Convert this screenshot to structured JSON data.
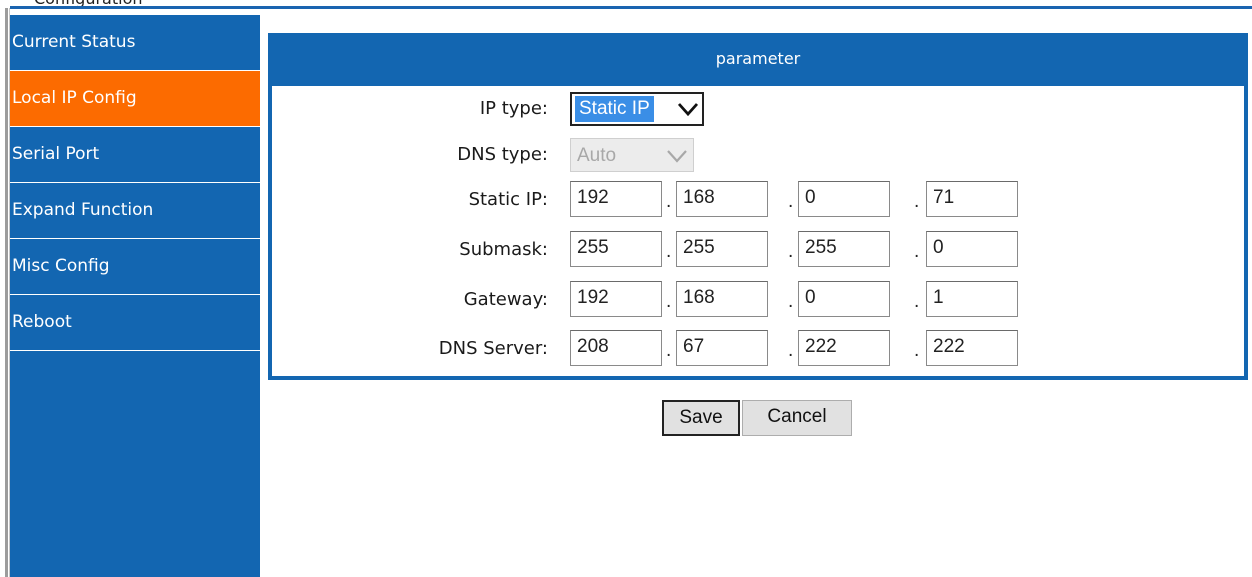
{
  "window": {
    "top_cut_text": "Configuration"
  },
  "sidebar": {
    "items": [
      {
        "label": "Current Status",
        "active": false
      },
      {
        "label": "Local IP Config",
        "active": true
      },
      {
        "label": "Serial Port",
        "active": false
      },
      {
        "label": "Expand Function",
        "active": false
      },
      {
        "label": "Misc Config",
        "active": false
      },
      {
        "label": "Reboot",
        "active": false
      }
    ]
  },
  "panel": {
    "title": "parameter",
    "ip_type": {
      "label": "IP type:",
      "value": "Static IP",
      "arrow_icon": "chevron-down-icon"
    },
    "dns_type": {
      "label": "DNS type:",
      "value": "Auto",
      "disabled": true,
      "arrow_icon": "chevron-down-icon"
    },
    "static_ip": {
      "label": "Static IP:",
      "octets": [
        "192",
        "168",
        "0",
        "71"
      ]
    },
    "submask": {
      "label": "Submask:",
      "octets": [
        "255",
        "255",
        "255",
        "0"
      ]
    },
    "gateway": {
      "label": "Gateway:",
      "octets": [
        "192",
        "168",
        "0",
        "1"
      ]
    },
    "dns_server": {
      "label": "DNS Server:",
      "octets": [
        "208",
        "67",
        "222",
        "222"
      ]
    },
    "separator": "."
  },
  "buttons": {
    "save_label": "Save",
    "cancel_label": "Cancel"
  },
  "colors": {
    "nav_blue": "#1366b1",
    "active_orange": "#fc6b00",
    "select_highlight": "#3a8ee6"
  }
}
